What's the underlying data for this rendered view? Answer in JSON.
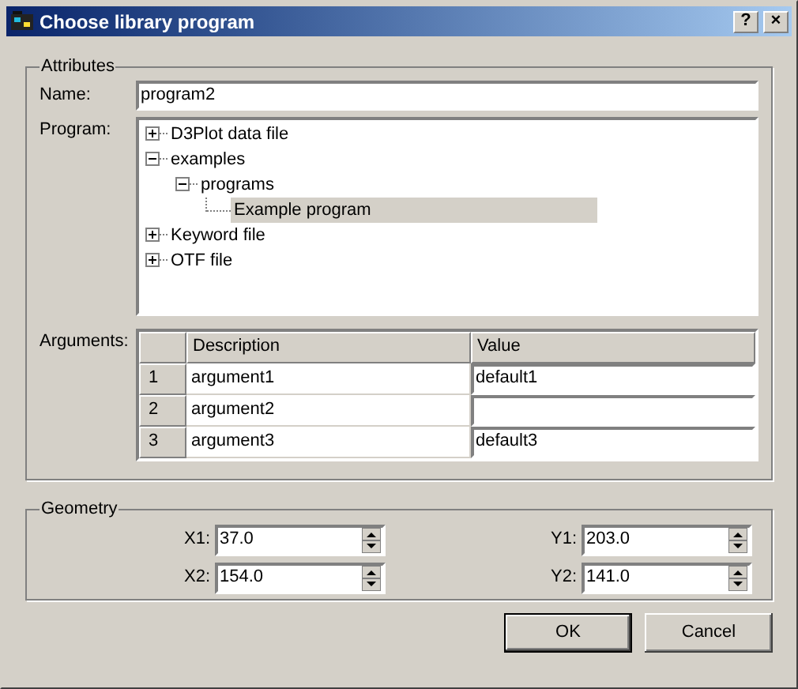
{
  "window": {
    "title": "Choose library program",
    "buttons": [
      "?",
      "×"
    ]
  },
  "attributes": {
    "title": "Attributes",
    "name_label": "Name:",
    "name_value": "program2",
    "program_label": "Program:",
    "tree": [
      {
        "label": "D3Plot data file",
        "expanded": false,
        "selected": false
      },
      {
        "label": "examples",
        "expanded": true,
        "selected": false,
        "children": [
          {
            "label": "programs",
            "expanded": true,
            "selected": false,
            "children": [
              {
                "label": "Example program",
                "selected": true
              }
            ]
          }
        ]
      },
      {
        "label": "Keyword file",
        "expanded": false,
        "selected": false
      },
      {
        "label": "OTF file",
        "expanded": false,
        "selected": false
      }
    ],
    "arguments_label": "Arguments:",
    "columns": [
      "Description",
      "Value"
    ],
    "rows": [
      {
        "index": "1",
        "description": "argument1",
        "value": "default1"
      },
      {
        "index": "2",
        "description": "argument2"
      },
      {
        "index": "3",
        "description": "argument3",
        "value": "default3"
      }
    ]
  },
  "geometry": {
    "title": "Geometry",
    "left": [
      {
        "label": "X1:",
        "value": "37.0"
      },
      {
        "label": "X2:",
        "value": "154.0"
      }
    ],
    "right": [
      {
        "label": "Y1:",
        "value": "203.0"
      },
      {
        "label": "Y2:",
        "value": "141.0"
      }
    ]
  },
  "buttons": [
    {
      "label": "OK",
      "default": true
    },
    {
      "label": "Cancel",
      "default": false
    }
  ]
}
